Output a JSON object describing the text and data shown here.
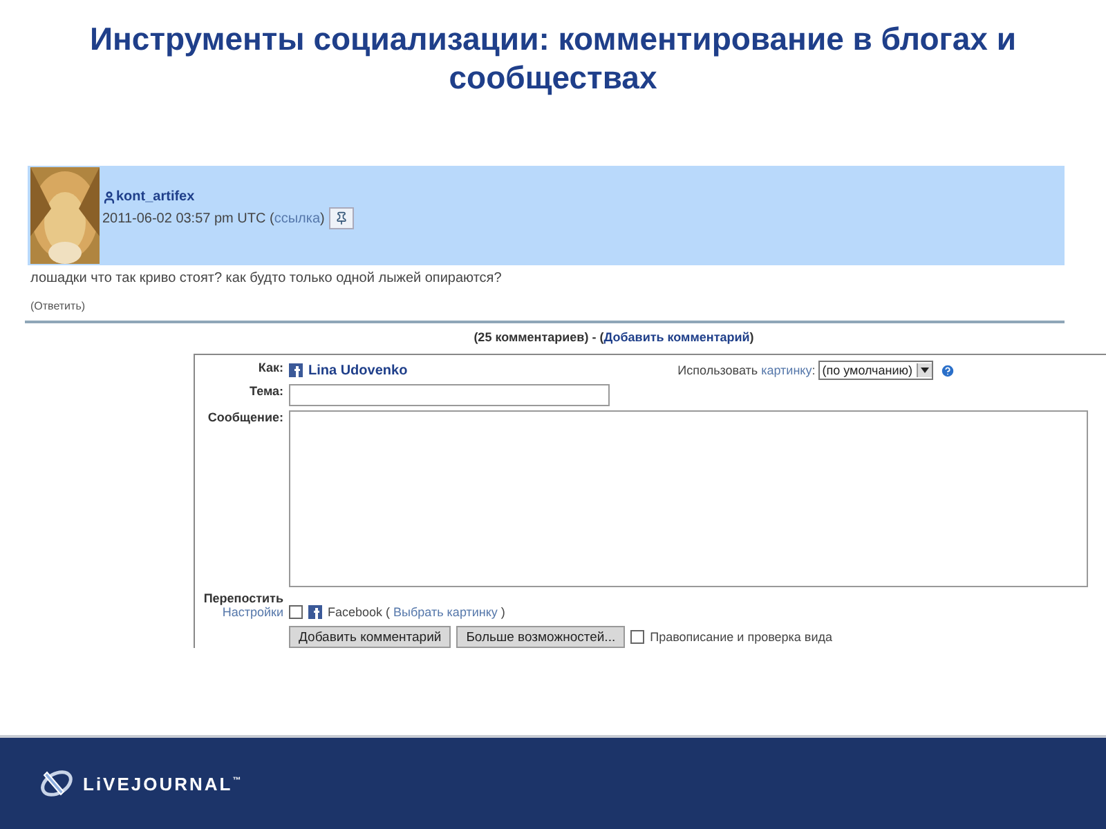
{
  "title": "Инструменты социализации: комментирование в блогах и сообществах",
  "post": {
    "username": "kont_artifex",
    "timestamp": "2011-06-02 03:57 pm UTC",
    "link_open": "(",
    "link_text": "ссылка",
    "link_close": ")",
    "body": "лошадки что так криво стоят? как будто только одной лыжей опираются?",
    "reply": "(Ответить)"
  },
  "comments_bar": {
    "before": "(25 комментариев) - (",
    "link": "Добавить комментарий",
    "after": ")"
  },
  "form": {
    "as_label": "Как:",
    "user": "Lina Udovenko",
    "userpic_prefix": "Использовать",
    "userpic_link": "картинку",
    "userpic_suffix": ":",
    "userpic_select": "(по умолчанию)",
    "subject_label": "Тема:",
    "message_label": "Сообщение:",
    "repost_label": "Перепостить",
    "settings_link": "Настройки",
    "facebook": {
      "checked": false,
      "before": "Facebook (",
      "link": "Выбрать картинку",
      "after": ")"
    },
    "buttons": [
      "Добавить комментарий",
      "Больше возможностей..."
    ],
    "spellcheck": {
      "checked": false,
      "label": "Правописание и проверка вида"
    }
  },
  "footer": {
    "logo": "LiVEJOURNAL",
    "trademark": "™"
  }
}
